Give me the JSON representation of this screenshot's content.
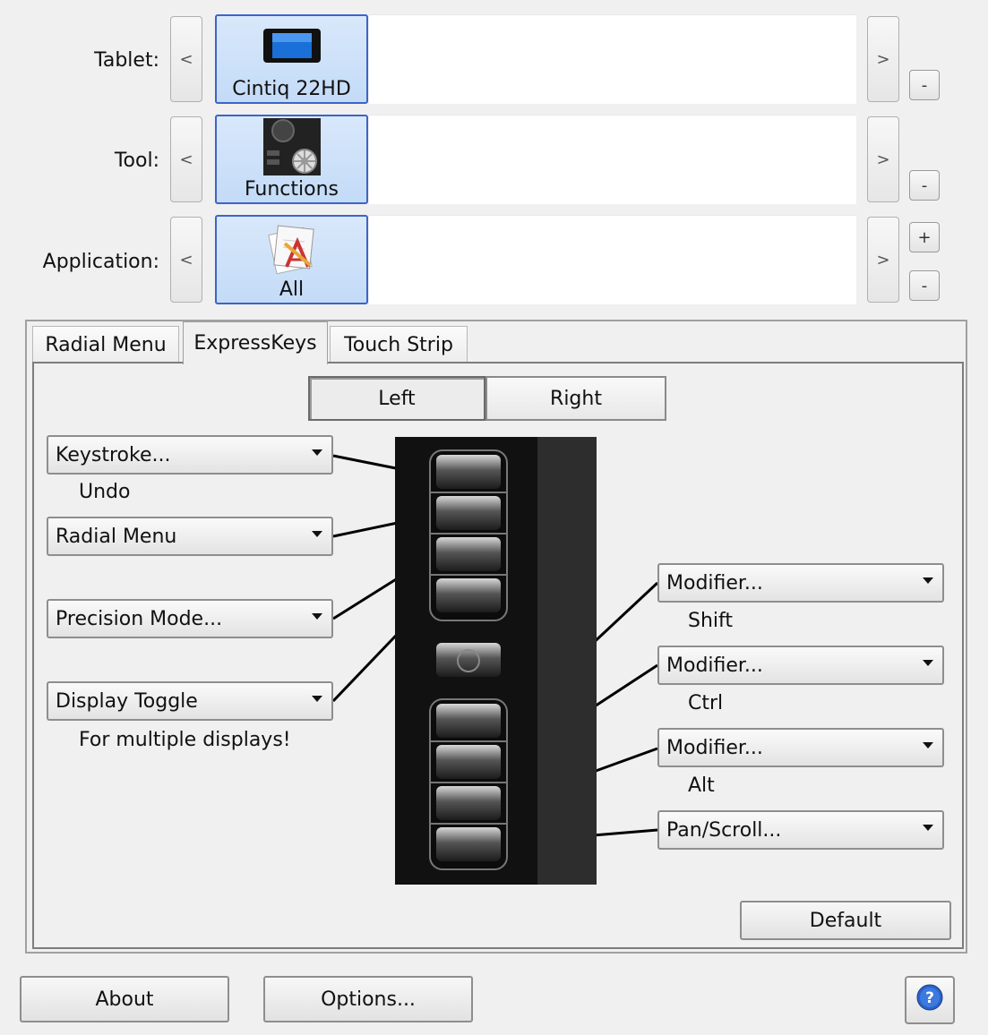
{
  "rows": {
    "tablet": {
      "label": "Tablet:",
      "tile": "Cintiq 22HD",
      "prev": "<",
      "next": ">",
      "remove": "-"
    },
    "tool": {
      "label": "Tool:",
      "tile": "Functions",
      "prev": "<",
      "next": ">",
      "remove": "-"
    },
    "application": {
      "label": "Application:",
      "tile": "All",
      "prev": "<",
      "next": ">",
      "add": "+",
      "remove": "-"
    }
  },
  "tabs": [
    "Radial Menu",
    "ExpressKeys",
    "Touch Strip"
  ],
  "active_tab": "ExpressKeys",
  "side_toggle": {
    "left": "Left",
    "right": "Right",
    "selected": "Left"
  },
  "left_keys": [
    {
      "dropdown": "Keystroke...",
      "sub": "Undo"
    },
    {
      "dropdown": "Radial Menu",
      "sub": ""
    },
    {
      "dropdown": "Precision Mode...",
      "sub": ""
    },
    {
      "dropdown": "Display Toggle",
      "sub": "For multiple displays!"
    }
  ],
  "right_keys": [
    {
      "dropdown": "Modifier...",
      "sub": "Shift"
    },
    {
      "dropdown": "Modifier...",
      "sub": "Ctrl"
    },
    {
      "dropdown": "Modifier...",
      "sub": "Alt"
    },
    {
      "dropdown": "Pan/Scroll...",
      "sub": ""
    }
  ],
  "buttons": {
    "default": "Default",
    "about": "About",
    "options": "Options..."
  },
  "colors": {
    "selection_border": "#3c64c8",
    "tile_fill": "#c3dbf7",
    "help_icon": "#2a62c9"
  }
}
